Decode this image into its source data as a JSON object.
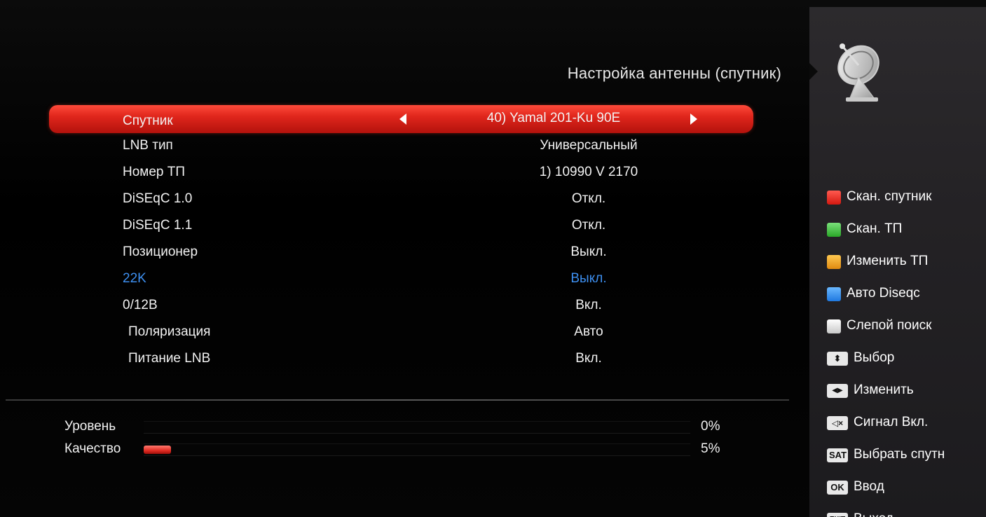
{
  "title": "Настройка антенны (спутник)",
  "menu": [
    {
      "label": "Спутник",
      "value": "40) Yamal 201-Ku 90E"
    },
    {
      "label": "LNB тип",
      "value": "Универсальный"
    },
    {
      "label": "Номер ТП",
      "value": "1) 10990 V 2170"
    },
    {
      "label": "DiSEqC 1.0",
      "value": "Откл."
    },
    {
      "label": "DiSEqC 1.1",
      "value": "Откл."
    },
    {
      "label": "Позиционер",
      "value": "Выкл."
    },
    {
      "label": "22K",
      "value": "Выкл."
    },
    {
      "label": "0/12B",
      "value": "Вкл."
    },
    {
      "label": "Поляризация",
      "value": "Авто"
    },
    {
      "label": "Питание LNB",
      "value": "Вкл."
    }
  ],
  "signal": {
    "level": {
      "label": "Уровень",
      "percent": "0%",
      "value": 0
    },
    "quality": {
      "label": "Качество",
      "percent": "5%",
      "value": 5
    }
  },
  "legend": [
    {
      "icon": "red-button-icon",
      "color": "#e8231c",
      "label": "Скан. спутник"
    },
    {
      "icon": "green-button-icon",
      "color": "#3cc23a",
      "label": "Скан. ТП"
    },
    {
      "icon": "yellow-button-icon",
      "color": "#f0a21a",
      "label": "Изменить ТП"
    },
    {
      "icon": "blue-button-icon",
      "color": "#2f8df0",
      "label": "Авто Diseqc"
    },
    {
      "icon": "white-button-icon",
      "color": "#e8e8e8",
      "label": "Слепой поиск"
    },
    {
      "icon": "up-down-key-icon",
      "key": "◆",
      "label": "Выбор"
    },
    {
      "icon": "left-right-key-icon",
      "key": "◀▶",
      "label": "Изменить"
    },
    {
      "icon": "mute-key-icon",
      "key": "🔇",
      "label": "Сигнал Вкл."
    },
    {
      "icon": "sat-key-icon",
      "key": "SAT",
      "label": "Выбрать спутн"
    },
    {
      "icon": "ok-key-icon",
      "key": "OK",
      "label": "Ввод"
    },
    {
      "icon": "exit-key-icon",
      "key": "EXIT",
      "label": "Выход"
    }
  ],
  "colors": {
    "selected_row": "#e0261c",
    "highlight_text": "#3d8ff0"
  }
}
